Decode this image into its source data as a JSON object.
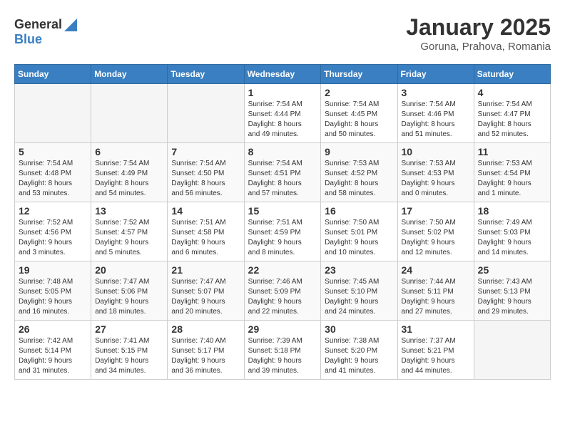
{
  "logo": {
    "line1": "General",
    "line2": "Blue"
  },
  "title": "January 2025",
  "location": "Goruna, Prahova, Romania",
  "days_header": [
    "Sunday",
    "Monday",
    "Tuesday",
    "Wednesday",
    "Thursday",
    "Friday",
    "Saturday"
  ],
  "weeks": [
    [
      {
        "day": "",
        "info": ""
      },
      {
        "day": "",
        "info": ""
      },
      {
        "day": "",
        "info": ""
      },
      {
        "day": "1",
        "info": "Sunrise: 7:54 AM\nSunset: 4:44 PM\nDaylight: 8 hours\nand 49 minutes."
      },
      {
        "day": "2",
        "info": "Sunrise: 7:54 AM\nSunset: 4:45 PM\nDaylight: 8 hours\nand 50 minutes."
      },
      {
        "day": "3",
        "info": "Sunrise: 7:54 AM\nSunset: 4:46 PM\nDaylight: 8 hours\nand 51 minutes."
      },
      {
        "day": "4",
        "info": "Sunrise: 7:54 AM\nSunset: 4:47 PM\nDaylight: 8 hours\nand 52 minutes."
      }
    ],
    [
      {
        "day": "5",
        "info": "Sunrise: 7:54 AM\nSunset: 4:48 PM\nDaylight: 8 hours\nand 53 minutes."
      },
      {
        "day": "6",
        "info": "Sunrise: 7:54 AM\nSunset: 4:49 PM\nDaylight: 8 hours\nand 54 minutes."
      },
      {
        "day": "7",
        "info": "Sunrise: 7:54 AM\nSunset: 4:50 PM\nDaylight: 8 hours\nand 56 minutes."
      },
      {
        "day": "8",
        "info": "Sunrise: 7:54 AM\nSunset: 4:51 PM\nDaylight: 8 hours\nand 57 minutes."
      },
      {
        "day": "9",
        "info": "Sunrise: 7:53 AM\nSunset: 4:52 PM\nDaylight: 8 hours\nand 58 minutes."
      },
      {
        "day": "10",
        "info": "Sunrise: 7:53 AM\nSunset: 4:53 PM\nDaylight: 9 hours\nand 0 minutes."
      },
      {
        "day": "11",
        "info": "Sunrise: 7:53 AM\nSunset: 4:54 PM\nDaylight: 9 hours\nand 1 minute."
      }
    ],
    [
      {
        "day": "12",
        "info": "Sunrise: 7:52 AM\nSunset: 4:56 PM\nDaylight: 9 hours\nand 3 minutes."
      },
      {
        "day": "13",
        "info": "Sunrise: 7:52 AM\nSunset: 4:57 PM\nDaylight: 9 hours\nand 5 minutes."
      },
      {
        "day": "14",
        "info": "Sunrise: 7:51 AM\nSunset: 4:58 PM\nDaylight: 9 hours\nand 6 minutes."
      },
      {
        "day": "15",
        "info": "Sunrise: 7:51 AM\nSunset: 4:59 PM\nDaylight: 9 hours\nand 8 minutes."
      },
      {
        "day": "16",
        "info": "Sunrise: 7:50 AM\nSunset: 5:01 PM\nDaylight: 9 hours\nand 10 minutes."
      },
      {
        "day": "17",
        "info": "Sunrise: 7:50 AM\nSunset: 5:02 PM\nDaylight: 9 hours\nand 12 minutes."
      },
      {
        "day": "18",
        "info": "Sunrise: 7:49 AM\nSunset: 5:03 PM\nDaylight: 9 hours\nand 14 minutes."
      }
    ],
    [
      {
        "day": "19",
        "info": "Sunrise: 7:48 AM\nSunset: 5:05 PM\nDaylight: 9 hours\nand 16 minutes."
      },
      {
        "day": "20",
        "info": "Sunrise: 7:47 AM\nSunset: 5:06 PM\nDaylight: 9 hours\nand 18 minutes."
      },
      {
        "day": "21",
        "info": "Sunrise: 7:47 AM\nSunset: 5:07 PM\nDaylight: 9 hours\nand 20 minutes."
      },
      {
        "day": "22",
        "info": "Sunrise: 7:46 AM\nSunset: 5:09 PM\nDaylight: 9 hours\nand 22 minutes."
      },
      {
        "day": "23",
        "info": "Sunrise: 7:45 AM\nSunset: 5:10 PM\nDaylight: 9 hours\nand 24 minutes."
      },
      {
        "day": "24",
        "info": "Sunrise: 7:44 AM\nSunset: 5:11 PM\nDaylight: 9 hours\nand 27 minutes."
      },
      {
        "day": "25",
        "info": "Sunrise: 7:43 AM\nSunset: 5:13 PM\nDaylight: 9 hours\nand 29 minutes."
      }
    ],
    [
      {
        "day": "26",
        "info": "Sunrise: 7:42 AM\nSunset: 5:14 PM\nDaylight: 9 hours\nand 31 minutes."
      },
      {
        "day": "27",
        "info": "Sunrise: 7:41 AM\nSunset: 5:15 PM\nDaylight: 9 hours\nand 34 minutes."
      },
      {
        "day": "28",
        "info": "Sunrise: 7:40 AM\nSunset: 5:17 PM\nDaylight: 9 hours\nand 36 minutes."
      },
      {
        "day": "29",
        "info": "Sunrise: 7:39 AM\nSunset: 5:18 PM\nDaylight: 9 hours\nand 39 minutes."
      },
      {
        "day": "30",
        "info": "Sunrise: 7:38 AM\nSunset: 5:20 PM\nDaylight: 9 hours\nand 41 minutes."
      },
      {
        "day": "31",
        "info": "Sunrise: 7:37 AM\nSunset: 5:21 PM\nDaylight: 9 hours\nand 44 minutes."
      },
      {
        "day": "",
        "info": ""
      }
    ]
  ]
}
